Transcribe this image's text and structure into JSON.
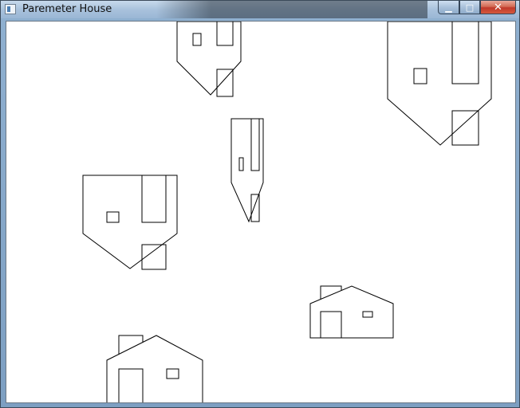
{
  "window": {
    "title": "Paremeter House",
    "controls": {
      "minimize_glyph": "▁",
      "maximize_glyph": "□",
      "close_glyph": "✕"
    }
  },
  "canvas": {
    "background": "#ffffff",
    "stroke": "#000000"
  }
}
